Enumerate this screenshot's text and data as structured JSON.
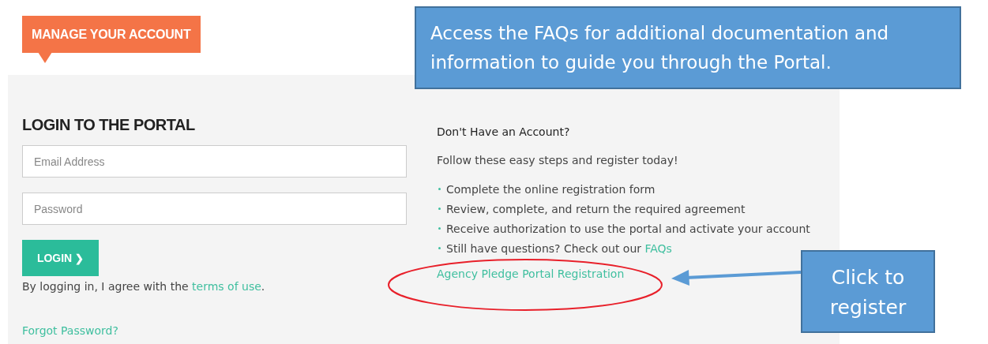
{
  "header_tag": "MANAGE YOUR ACCOUNT",
  "login": {
    "title": "LOGIN TO THE PORTAL",
    "fields": [
      {
        "placeholder": "Email Address"
      },
      {
        "placeholder": "Password"
      }
    ],
    "button": {
      "label": "LOGIN",
      "icon": "❯"
    },
    "agreement": {
      "text": "By logging in, I agree with the ",
      "link": "terms of use",
      "end": "."
    },
    "forgot_link": "Forgot Password?"
  },
  "register": {
    "title": "Don't Have an Account?",
    "intro": "Follow these easy steps and register today!",
    "steps": [
      {
        "text": "Complete the online registration form"
      },
      {
        "text": "Review, complete, and return the required agreement"
      },
      {
        "text": "Receive authorization to use the portal and activate your account"
      },
      {
        "text": "Still have questions? Check out our ",
        "link": "FAQs"
      }
    ],
    "link": "Agency Pledge Portal Registration"
  },
  "callouts": [
    {
      "text": "Access the FAQs for additional documentation and information to guide you through the Portal."
    },
    {
      "text": "Click to register"
    }
  ]
}
